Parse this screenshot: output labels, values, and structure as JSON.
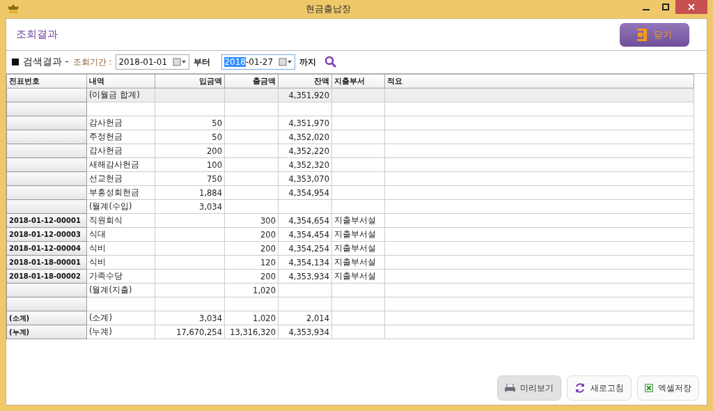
{
  "window": {
    "title": "현금출납장"
  },
  "header": {
    "title": "조회결과",
    "close_button": "닫기"
  },
  "search": {
    "section_label": "검색결과 -",
    "period_label": "조회기간 :",
    "from_field": {
      "parts": [
        {
          "text": "2018-01-01",
          "highlighted": false
        }
      ],
      "focused": false
    },
    "from_suffix": "부터",
    "to_field": {
      "parts": [
        {
          "text": "2018",
          "highlighted": true
        },
        {
          "text": "-01-27",
          "highlighted": false
        }
      ],
      "focused": true
    },
    "to_suffix": "까지"
  },
  "table": {
    "columns": [
      "전표번호",
      "내역",
      "입금액",
      "출금액",
      "잔액",
      "지출부서",
      "적요"
    ],
    "rows": [
      {
        "highlighted": true,
        "description": "(이월금 합계)",
        "balance": "4,351,920"
      },
      {
        "highlighted": false
      },
      {
        "highlighted": false,
        "description": "감사헌금",
        "deposit": "50",
        "balance": "4,351,970"
      },
      {
        "highlighted": false,
        "description": "주정헌금",
        "deposit": "50",
        "balance": "4,352,020"
      },
      {
        "highlighted": false,
        "description": "감사헌금",
        "deposit": "200",
        "balance": "4,352,220"
      },
      {
        "highlighted": false,
        "description": "새해감사헌금",
        "deposit": "100",
        "balance": "4,352,320"
      },
      {
        "highlighted": false,
        "description": "선교헌금",
        "deposit": "750",
        "balance": "4,353,070"
      },
      {
        "highlighted": false,
        "description": "부흥성회헌금",
        "deposit": "1,884",
        "balance": "4,354,954"
      },
      {
        "highlighted": false,
        "description": "(월계(수입)",
        "deposit": "3,034"
      },
      {
        "highlighted": false,
        "voucher": "2018-01-12-00001",
        "description": "직원회식",
        "withdrawal": "300",
        "balance": "4,354,654",
        "department": "지출부서설"
      },
      {
        "highlighted": false,
        "voucher": "2018-01-12-00003",
        "description": "식대",
        "withdrawal": "200",
        "balance": "4,354,454",
        "department": "지출부서설"
      },
      {
        "highlighted": false,
        "voucher": "2018-01-12-00004",
        "description": "식비",
        "withdrawal": "200",
        "balance": "4,354,254",
        "department": "지출부서설"
      },
      {
        "highlighted": false,
        "voucher": "2018-01-18-00001",
        "description": "식비",
        "withdrawal": "120",
        "balance": "4,354,134",
        "department": "지출부서설"
      },
      {
        "highlighted": false,
        "voucher": "2018-01-18-00002",
        "description": "가족수당",
        "withdrawal": "200",
        "balance": "4,353,934",
        "department": "지출부서설"
      },
      {
        "highlighted": false,
        "description": "(월계(지출)",
        "withdrawal": "1,020"
      },
      {
        "highlighted": false
      },
      {
        "highlighted": false,
        "voucher": "(소계)",
        "description": "(소계)",
        "deposit": "3,034",
        "withdrawal": "1,020",
        "balance": "2,014"
      },
      {
        "highlighted": false,
        "voucher": "(누계)",
        "description": "(누계)",
        "deposit": "17,670,254",
        "withdrawal": "13,316,320",
        "balance": "4,353,934"
      }
    ]
  },
  "footer_buttons": [
    {
      "kind": "print",
      "label": "미리보기",
      "pressed": true
    },
    {
      "kind": "refresh",
      "label": "새로고침",
      "pressed": false
    },
    {
      "kind": "excel",
      "label": "엑셀저장",
      "pressed": false
    }
  ]
}
